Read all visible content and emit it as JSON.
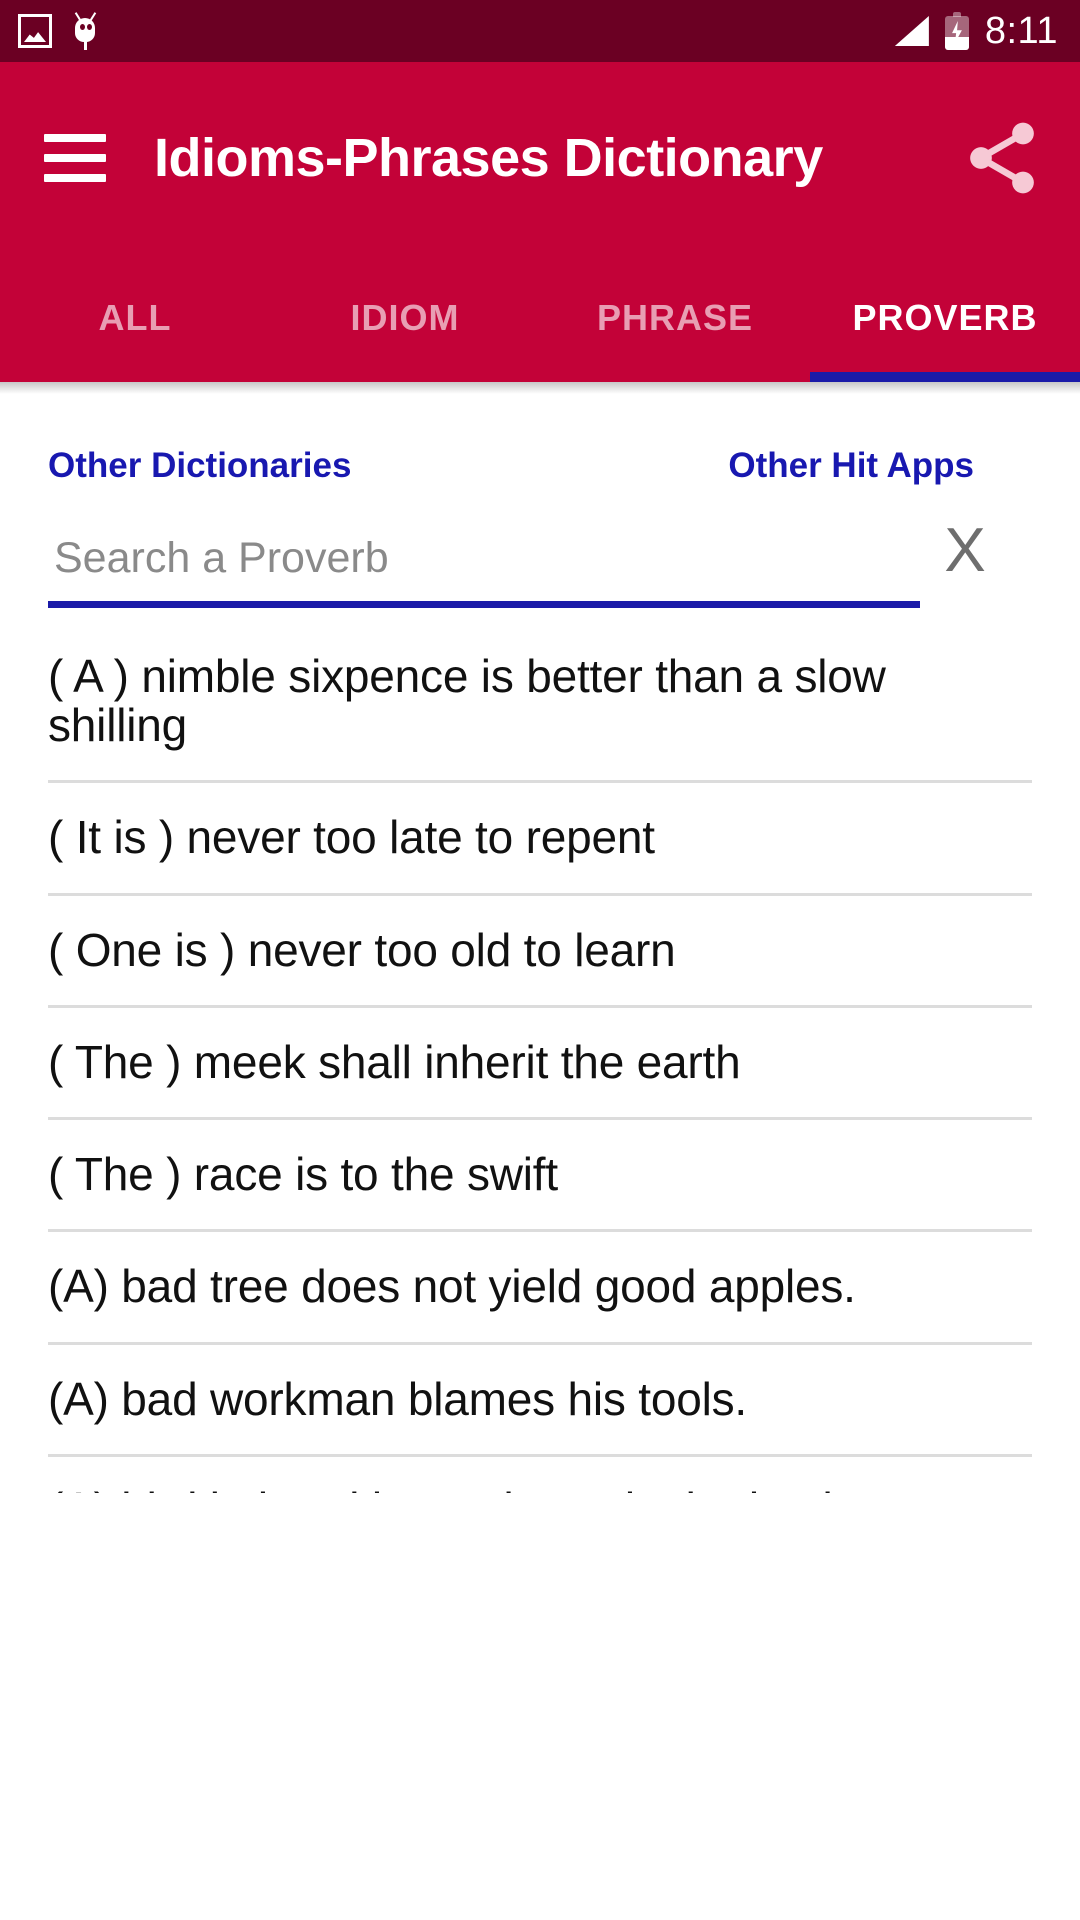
{
  "status_bar": {
    "time": "8:11",
    "icons": [
      "image-icon",
      "android-bug-icon",
      "signal-icon",
      "battery-charging-icon"
    ]
  },
  "app_bar": {
    "menu_icon": "hamburger-menu-icon",
    "title": "Idioms-Phrases Dictionary",
    "share_icon": "share-icon",
    "background_color": "#C30238"
  },
  "tabs": {
    "items": [
      {
        "label": "ALL",
        "active": false
      },
      {
        "label": "IDIOM",
        "active": false
      },
      {
        "label": "PHRASE",
        "active": false
      },
      {
        "label": "PROVERB",
        "active": true
      }
    ],
    "indicator_color": "#1B1BA8"
  },
  "links": {
    "left": "Other Dictionaries",
    "right": "Other Hit Apps",
    "color": "#1818B0"
  },
  "search": {
    "placeholder": "Search a Proverb",
    "value": "",
    "clear_label": "X",
    "underline_color": "#1B1BA8"
  },
  "list": {
    "items": [
      {
        "text": "( A ) nimble sixpence is better than a slow shilling"
      },
      {
        "text": "( It is ) never too late to repent"
      },
      {
        "text": "( One is ) never too old to learn"
      },
      {
        "text": "( The ) meek shall inherit the earth"
      },
      {
        "text": "( The ) race is to the swift"
      },
      {
        "text": "(A) bad tree does not yield good apples."
      },
      {
        "text": "(A) bad workman blames his tools."
      },
      {
        "text": "(A) bird in hand is worth two in the bush."
      }
    ]
  }
}
